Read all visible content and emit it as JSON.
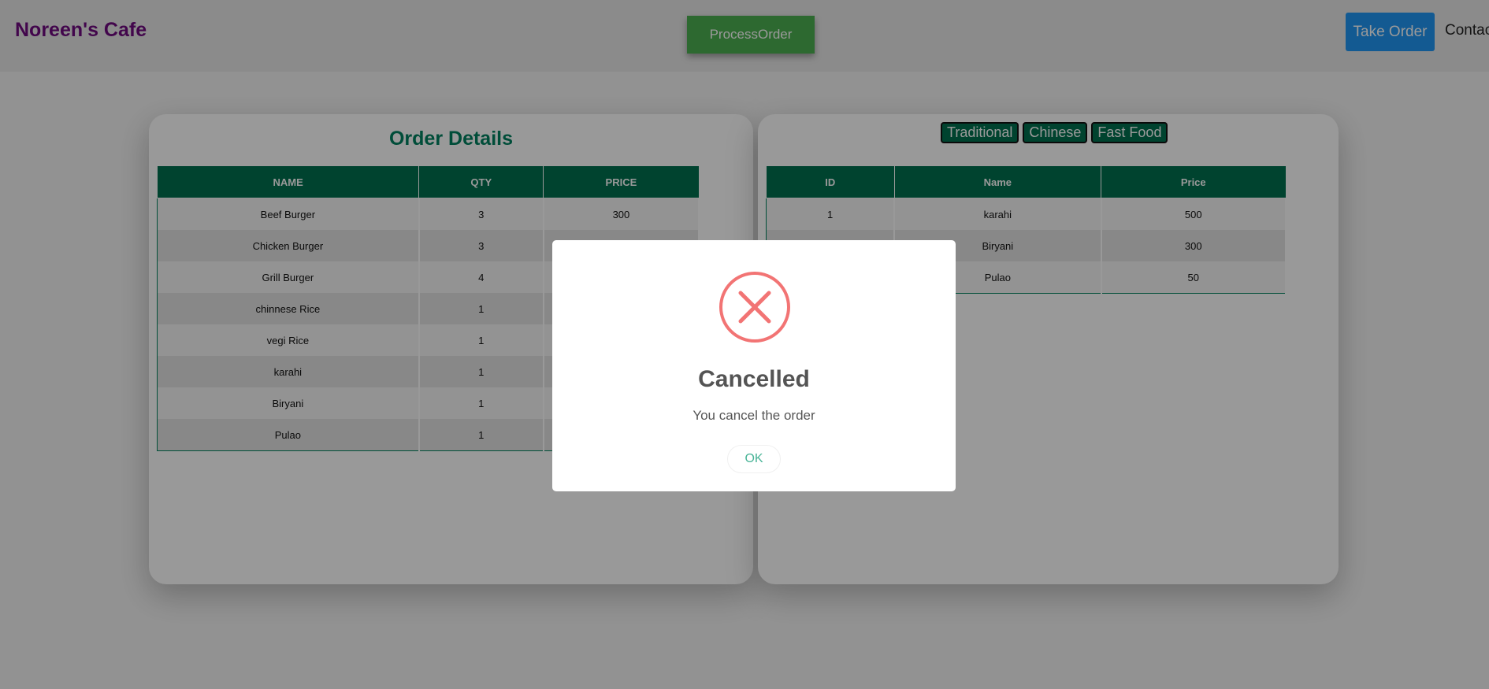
{
  "navbar": {
    "brand": "Noreen's Cafe",
    "process_label": "ProcessOrder",
    "take_order_label": "Take Order",
    "contact_label": "Contac"
  },
  "order_details": {
    "title": "Order Details",
    "columns": [
      "NAME",
      "QTY",
      "PRICE"
    ],
    "rows": [
      {
        "name": "Beef Burger",
        "qty": "3",
        "price": "300"
      },
      {
        "name": "Chicken Burger",
        "qty": "3",
        "price": ""
      },
      {
        "name": "Grill Burger",
        "qty": "4",
        "price": ""
      },
      {
        "name": "chinnese Rice",
        "qty": "1",
        "price": ""
      },
      {
        "name": "vegi Rice",
        "qty": "1",
        "price": ""
      },
      {
        "name": "karahi",
        "qty": "1",
        "price": ""
      },
      {
        "name": "Biryani",
        "qty": "1",
        "price": ""
      },
      {
        "name": "Pulao",
        "qty": "1",
        "price": ""
      }
    ]
  },
  "menu": {
    "categories": [
      "Traditional",
      "Chinese",
      "Fast Food"
    ],
    "columns": [
      "ID",
      "Name",
      "Price"
    ],
    "rows": [
      {
        "id": "1",
        "name": "karahi",
        "price": "500"
      },
      {
        "id": "",
        "name": "Biryani",
        "price": "300"
      },
      {
        "id": "",
        "name": "Pulao",
        "price": "50"
      }
    ]
  },
  "dialog": {
    "icon": "error-x-icon",
    "title": "Cancelled",
    "message": "You cancel the order",
    "ok_label": "OK"
  },
  "colors": {
    "brand": "#6f0a7f",
    "table_header": "#00704f",
    "process_button": "#4caf50",
    "take_order_button": "#2196f3",
    "error": "#f27474",
    "ok_text": "#49b497"
  }
}
